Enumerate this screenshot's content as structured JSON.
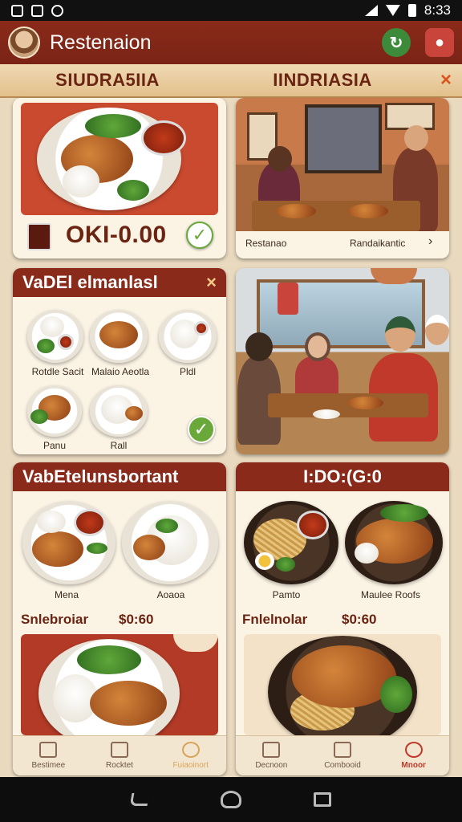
{
  "status_bar": {
    "time": "8:33"
  },
  "app_bar": {
    "title": "Restenaion"
  },
  "tabs": {
    "left": "SIUDRA5IIA",
    "right": "IINDRIASIA",
    "close": "×"
  },
  "card1": {
    "price": "OKI-0.00"
  },
  "card2": {
    "caption_left": "Restanao",
    "caption_right": "Randaikantic",
    "arrow": "›"
  },
  "card3": {
    "title": "VaDEl elmanlasl",
    "close": "×",
    "items": [
      "Rotdle Sacit",
      "Malaio Aeotla",
      "Pldl",
      "Panu",
      "Rall"
    ]
  },
  "card5": {
    "title": "VabEtelunsbortant",
    "items": [
      "Mena",
      "Aoaoa"
    ],
    "price_label": "Snlebroiar",
    "price": "$0:60"
  },
  "card6": {
    "title": "I:DO:(G:0",
    "items": [
      "Pamto",
      "Maulee Roofs"
    ],
    "price_label": "Fnlelnolar",
    "price": "$0:60"
  },
  "bottom_nav_left": [
    "Bestimee",
    "Rocktet",
    "Fuiaoinort"
  ],
  "bottom_nav_right": [
    "Decnoon",
    "Combooid",
    "Mnoor"
  ],
  "colors": {
    "primary": "#8a2a1a",
    "accent": "#c0392b",
    "success": "#6aa83a"
  }
}
